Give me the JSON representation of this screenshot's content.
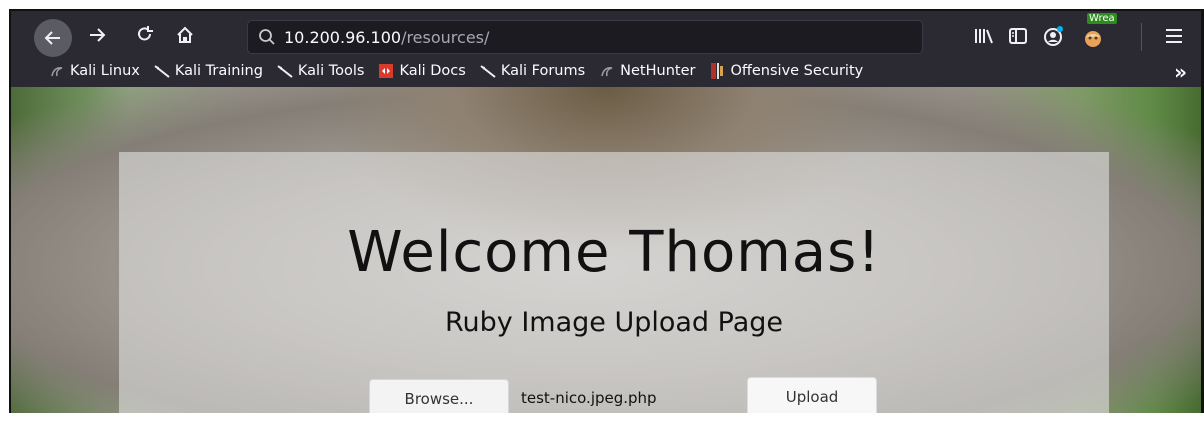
{
  "browser": {
    "url_host": "10.200.96.100",
    "url_path": "/resources/",
    "extension_badge": "Wrea"
  },
  "bookmarks": [
    {
      "label": "Kali Linux",
      "icon": "kali-dragon-icon"
    },
    {
      "label": "Kali Training",
      "icon": "kali-blade-icon"
    },
    {
      "label": "Kali Tools",
      "icon": "kali-blade-icon"
    },
    {
      "label": "Kali Docs",
      "icon": "kali-docs-icon"
    },
    {
      "label": "Kali Forums",
      "icon": "kali-blade-icon"
    },
    {
      "label": "NetHunter",
      "icon": "kali-dragon-icon"
    },
    {
      "label": "Offensive Security",
      "icon": "offsec-icon"
    }
  ],
  "page": {
    "title": "Welcome Thomas!",
    "subtitle": "Ruby Image Upload Page",
    "browse_label": "Browse...",
    "filename": "test-nico.jpeg.php",
    "upload_label": "Upload"
  },
  "colors": {
    "toolbar_bg": "#2b2a33",
    "urlbar_bg": "#1c1b22",
    "panel_bg": "rgba(222,222,222,0.62)"
  }
}
